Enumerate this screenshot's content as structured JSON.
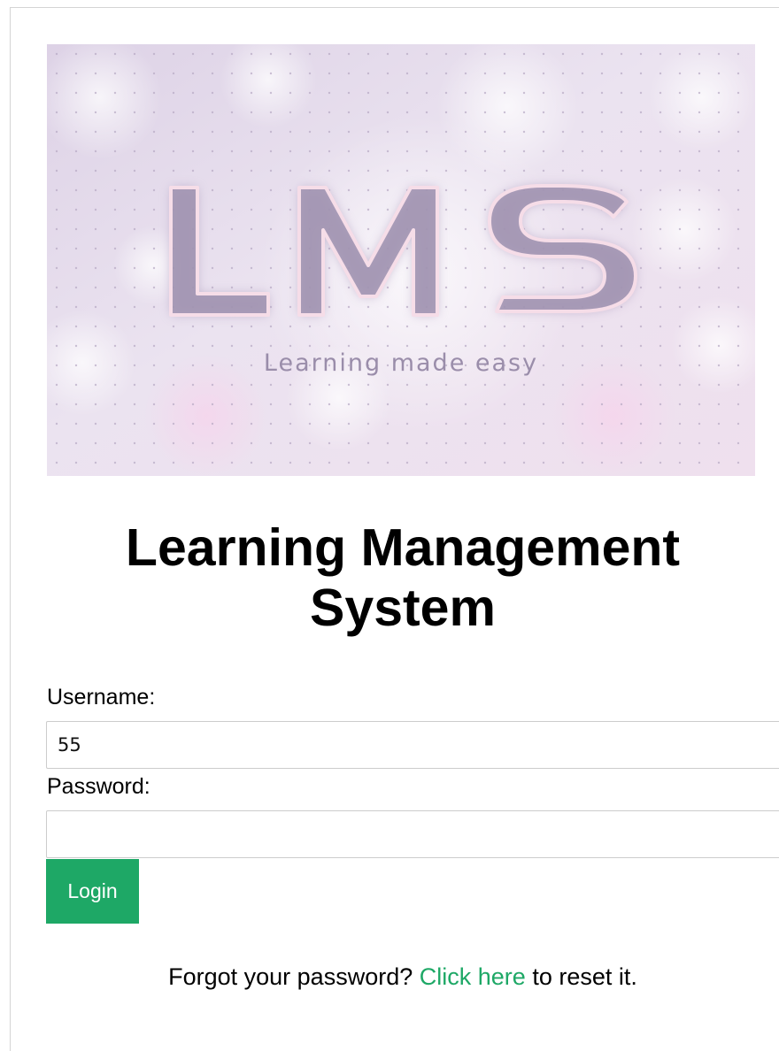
{
  "banner": {
    "logo_text": "LMS",
    "tagline": "Learning made easy"
  },
  "page_title": "Learning Management System",
  "form": {
    "username_label": "Username:",
    "username_value": "55",
    "password_label": "Password:",
    "password_value": "",
    "login_label": "Login"
  },
  "forgot": {
    "prefix": "Forgot your password?",
    "link_text": "Click here",
    "suffix": "to reset it."
  },
  "colors": {
    "accent": "#1ea866",
    "banner_bg": "#e6dcec",
    "logo_fill": "#9f93ad",
    "logo_outline": "#f3d6e4"
  }
}
